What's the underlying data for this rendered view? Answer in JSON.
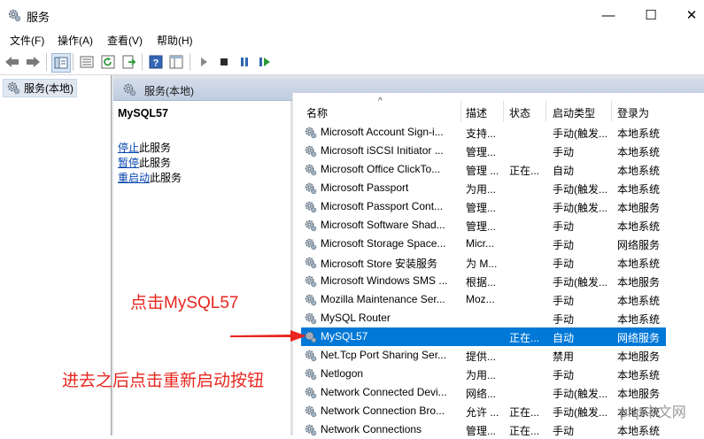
{
  "window": {
    "title": "服务",
    "minimize": "—",
    "maximize": "☐",
    "close": "✕"
  },
  "menu": [
    "文件(F)",
    "操作(A)",
    "查看(V)",
    "帮助(H)"
  ],
  "toolbar": {
    "icons": [
      "back-icon",
      "forward-icon",
      "show-hide-tree-icon",
      "properties-icon",
      "refresh-icon",
      "export-icon",
      "help-icon",
      "view-icon",
      "start-service-icon",
      "stop-service-icon",
      "pause-service-icon",
      "restart-service-icon"
    ]
  },
  "tree": {
    "item": "服务(本地)"
  },
  "panel": {
    "header": "服务(本地)",
    "selected_service": "MySQL57",
    "actions": [
      {
        "link": "停止",
        "rest": "此服务"
      },
      {
        "link": "暂停",
        "rest": "此服务"
      },
      {
        "link": "重启动",
        "rest": "此服务"
      }
    ]
  },
  "list": {
    "columns": [
      "名称",
      "描述",
      "状态",
      "启动类型",
      "登录为"
    ],
    "sort_indicator": "^",
    "rows": [
      {
        "name": "Microsoft Account Sign-i...",
        "desc": "支持...",
        "status": "",
        "startup": "手动(触发...",
        "logon": "本地系统"
      },
      {
        "name": "Microsoft iSCSI Initiator ...",
        "desc": "管理...",
        "status": "",
        "startup": "手动",
        "logon": "本地系统"
      },
      {
        "name": "Microsoft Office ClickTo...",
        "desc": "管理 ...",
        "status": "正在...",
        "startup": "自动",
        "logon": "本地系统"
      },
      {
        "name": "Microsoft Passport",
        "desc": "为用...",
        "status": "",
        "startup": "手动(触发...",
        "logon": "本地系统"
      },
      {
        "name": "Microsoft Passport Cont...",
        "desc": "管理...",
        "status": "",
        "startup": "手动(触发...",
        "logon": "本地服务"
      },
      {
        "name": "Microsoft Software Shad...",
        "desc": "管理...",
        "status": "",
        "startup": "手动",
        "logon": "本地系统"
      },
      {
        "name": "Microsoft Storage Space...",
        "desc": "Micr...",
        "status": "",
        "startup": "手动",
        "logon": "网络服务"
      },
      {
        "name": "Microsoft Store 安装服务",
        "desc": "为 M...",
        "status": "",
        "startup": "手动",
        "logon": "本地系统"
      },
      {
        "name": "Microsoft Windows SMS ...",
        "desc": "根据...",
        "status": "",
        "startup": "手动(触发...",
        "logon": "本地服务"
      },
      {
        "name": "Mozilla Maintenance Ser...",
        "desc": "Moz...",
        "status": "",
        "startup": "手动",
        "logon": "本地系统"
      },
      {
        "name": "MySQL Router",
        "desc": "",
        "status": "",
        "startup": "手动",
        "logon": "本地系统"
      },
      {
        "name": "MySQL57",
        "desc": "",
        "status": "正在...",
        "startup": "自动",
        "logon": "网络服务",
        "selected": true
      },
      {
        "name": "Net.Tcp Port Sharing Ser...",
        "desc": "提供...",
        "status": "",
        "startup": "禁用",
        "logon": "本地服务"
      },
      {
        "name": "Netlogon",
        "desc": "为用...",
        "status": "",
        "startup": "手动",
        "logon": "本地系统"
      },
      {
        "name": "Network Connected Devi...",
        "desc": "网络...",
        "status": "",
        "startup": "手动(触发...",
        "logon": "本地服务"
      },
      {
        "name": "Network Connection Bro...",
        "desc": "允许 ...",
        "status": "正在...",
        "startup": "手动(触发...",
        "logon": "本地系统"
      },
      {
        "name": "Network Connections",
        "desc": "管理...",
        "status": "正在...",
        "startup": "手动",
        "logon": "本地系统"
      }
    ]
  },
  "annotations": {
    "click_text": "点击MySQL57",
    "restart_text": "进去之后点击重新启动按钮",
    "arrow_color": "#e8261f"
  },
  "watermark": "php中文网",
  "colors": {
    "selection": "#0078d7",
    "annotation": "#e8261f",
    "link": "#0645ad"
  }
}
